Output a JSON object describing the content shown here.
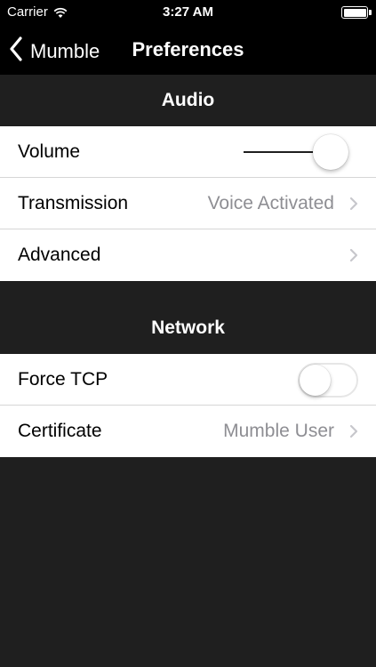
{
  "status_bar": {
    "carrier": "Carrier",
    "time": "3:27 AM",
    "wifi_icon": "wifi-icon",
    "battery_icon": "battery-icon",
    "battery_level": 1.0
  },
  "nav": {
    "back_label": "Mumble",
    "back_icon": "chevron-left-icon",
    "title": "Preferences"
  },
  "sections": {
    "audio": {
      "title": "Audio",
      "volume": {
        "label": "Volume",
        "level": 0.87
      },
      "transmission": {
        "label": "Transmission",
        "value": "Voice Activated"
      },
      "advanced": {
        "label": "Advanced"
      }
    },
    "network": {
      "title": "Network",
      "force_tcp": {
        "label": "Force TCP",
        "enabled": false
      },
      "certificate": {
        "label": "Certificate",
        "value": "Mumble User"
      }
    }
  },
  "colors": {
    "background": "#1f1f1f",
    "bar": "#000000",
    "cell": "#ffffff",
    "secondary_text": "#8e8e93",
    "chevron": "#c7c7cc"
  }
}
